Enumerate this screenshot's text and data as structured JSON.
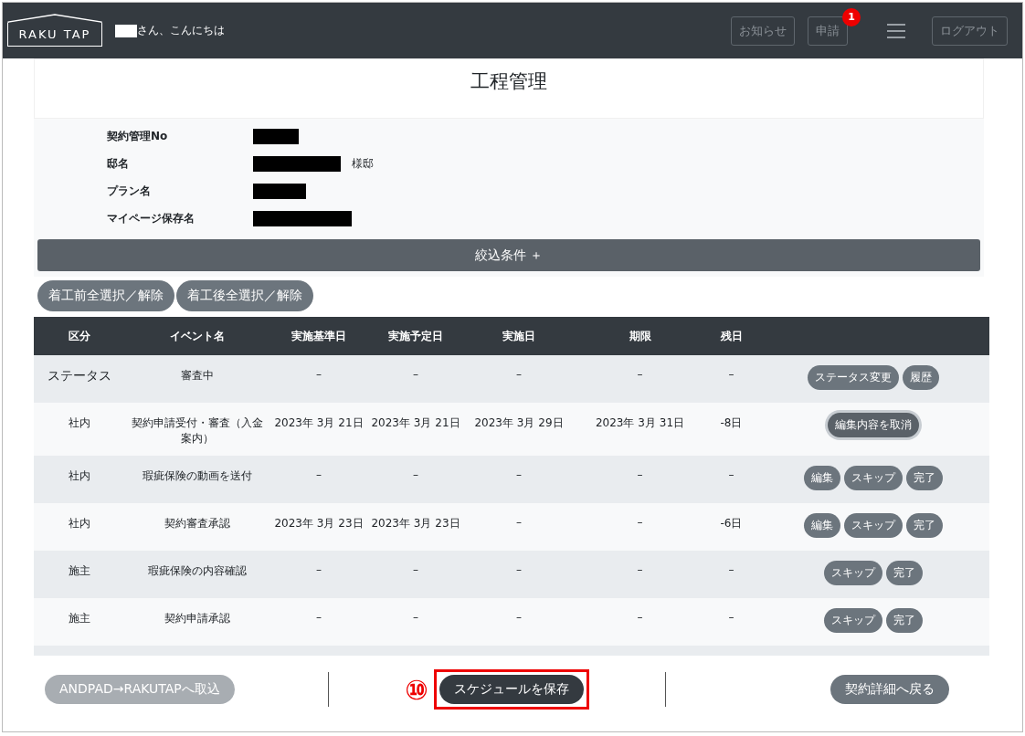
{
  "header": {
    "logo": "RAKU TAP",
    "greeting": "さん、こんにちは",
    "buttons": [
      {
        "label": "お知らせ"
      },
      {
        "label": "申請",
        "badge": "1"
      }
    ],
    "logout": "ログアウト"
  },
  "page_title": "工程管理",
  "info": [
    {
      "label": "契約管理No"
    },
    {
      "label": "邸名",
      "suffix": "様邸"
    },
    {
      "label": "プラン名"
    },
    {
      "label": "マイページ保存名"
    }
  ],
  "filter_bar": "絞込条件 ＋",
  "select_buttons": [
    "着工前全選択／解除",
    "着工後全選択／解除"
  ],
  "table": {
    "columns": [
      "区分",
      "イベント名",
      "実施基準日",
      "実施予定日",
      "実施日",
      "期限",
      "残日"
    ],
    "rows": [
      {
        "cells": [
          "ステータス",
          "審査中",
          "–",
          "–",
          "–",
          "–",
          "–"
        ],
        "kind": "status",
        "actions": [
          {
            "label": "ステータス変更",
            "focused": false
          },
          {
            "label": "履歴",
            "focused": false
          }
        ]
      },
      {
        "cells": [
          "社内",
          "契約申請受付・審査（入金案内）",
          "2023年 3月 21日",
          "2023年 3月 21日",
          "2023年 3月 29日",
          "2023年 3月 31日",
          "-8日"
        ],
        "kind": "event",
        "actions": [
          {
            "label": "編集内容を取消",
            "focused": true
          }
        ]
      },
      {
        "cells": [
          "社内",
          "瑕疵保険の動画を送付",
          "–",
          "–",
          "–",
          "–",
          "–"
        ],
        "kind": "event",
        "actions": [
          {
            "label": "編集",
            "focused": false
          },
          {
            "label": "スキップ",
            "focused": false
          },
          {
            "label": "完了",
            "focused": false
          }
        ]
      },
      {
        "cells": [
          "社内",
          "契約審査承認",
          "2023年 3月 23日",
          "2023年 3月 23日",
          "–",
          "–",
          "-6日"
        ],
        "kind": "event",
        "actions": [
          {
            "label": "編集",
            "focused": false
          },
          {
            "label": "スキップ",
            "focused": false
          },
          {
            "label": "完了",
            "focused": false
          }
        ]
      },
      {
        "cells": [
          "施主",
          "瑕疵保険の内容確認",
          "–",
          "–",
          "–",
          "–",
          "–"
        ],
        "kind": "event",
        "actions": [
          {
            "label": "スキップ",
            "focused": false
          },
          {
            "label": "完了",
            "focused": false
          }
        ]
      },
      {
        "cells": [
          "施主",
          "契約申請承認",
          "–",
          "–",
          "–",
          "–",
          "–"
        ],
        "kind": "event",
        "actions": [
          {
            "label": "スキップ",
            "focused": false
          },
          {
            "label": "完了",
            "focused": false
          }
        ]
      }
    ]
  },
  "footer": {
    "import_button": {
      "label": "ANDPAD→RAKUTAPへ取込",
      "disabled": true
    },
    "step_marker": "⑩",
    "save_button": {
      "label": "スケジュールを保存",
      "highlighted": true
    },
    "back_button": "契約詳細へ戻る"
  }
}
